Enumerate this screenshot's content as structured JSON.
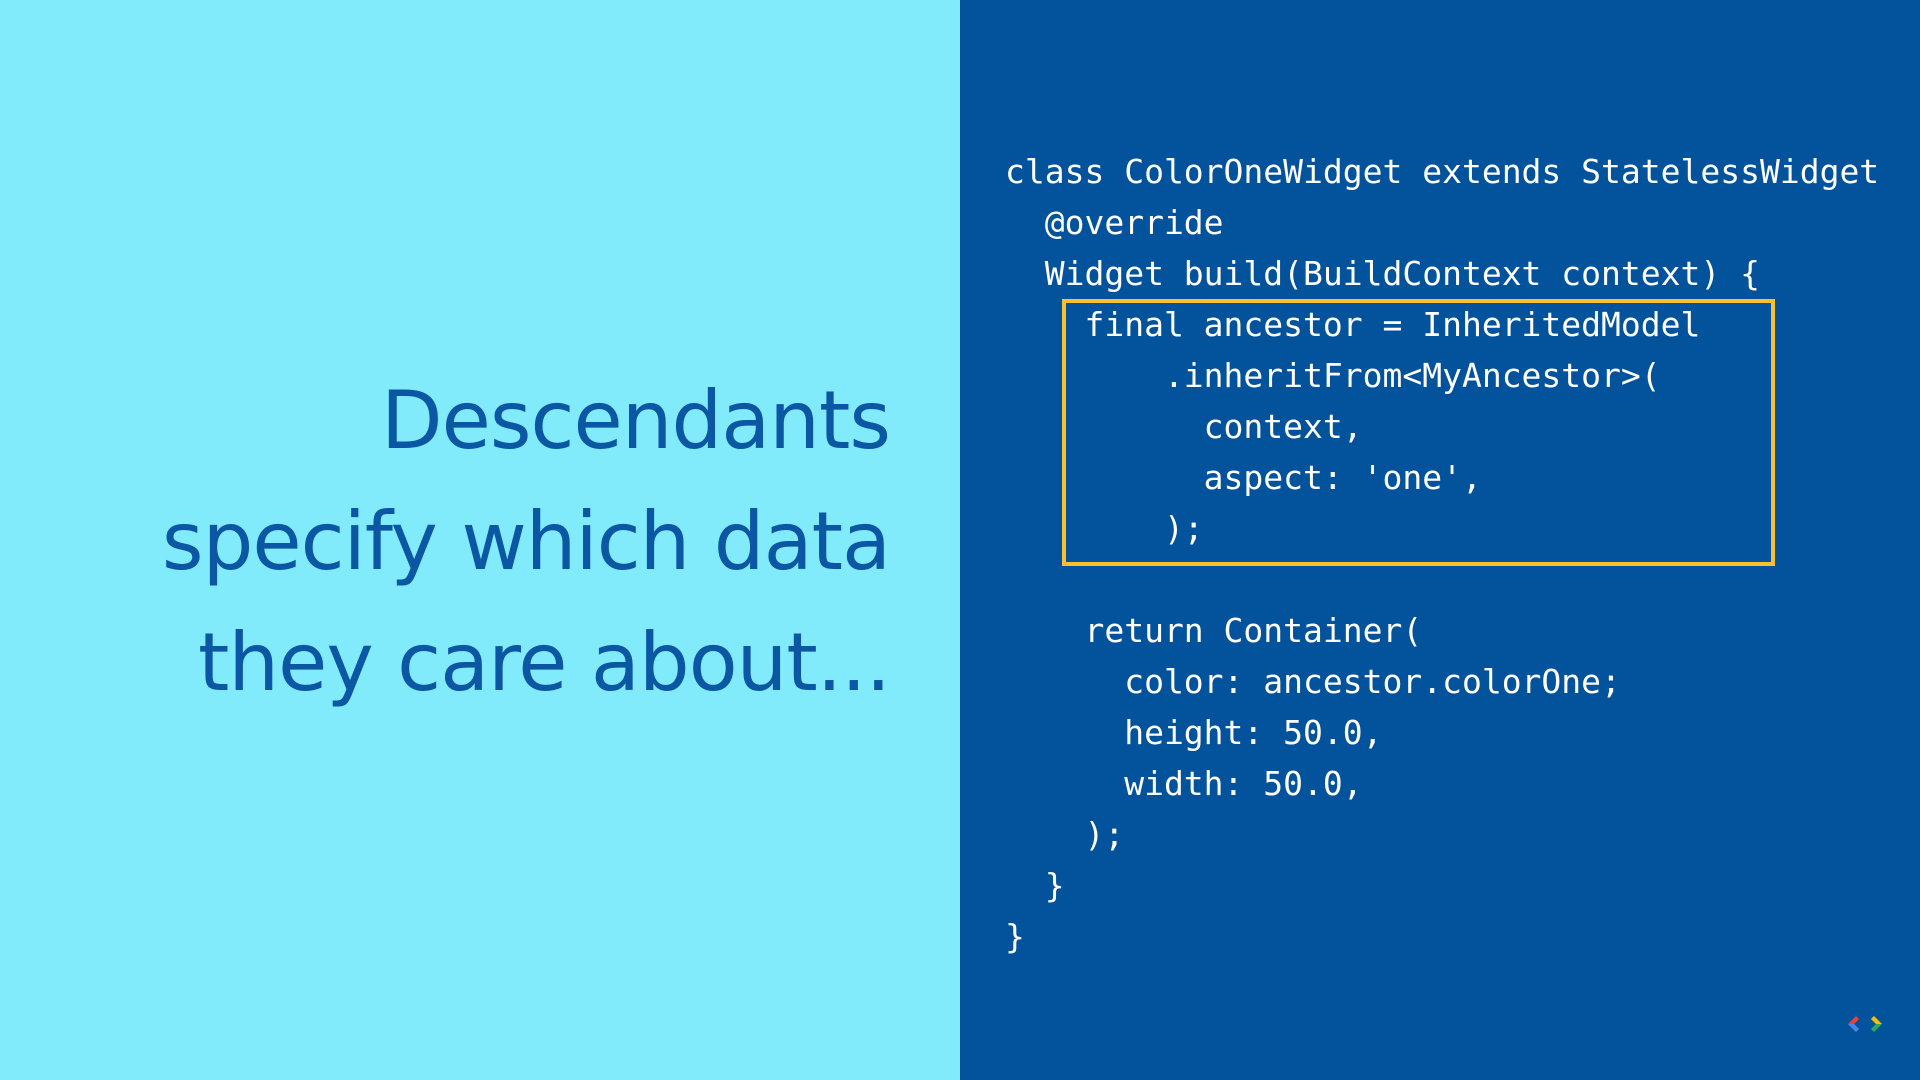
{
  "slide": {
    "headline_lines": [
      "Descendants",
      "specify which data",
      "they care about..."
    ]
  },
  "code": {
    "lines": [
      "class ColorOneWidget extends StatelessWidget",
      "  @override",
      "  Widget build(BuildContext context) {",
      "    final ancestor = InheritedModel",
      "        .inheritFrom<MyAncestor>(",
      "          context,",
      "          aspect: 'one',",
      "        );",
      "",
      "    return Container(",
      "      color: ancestor.colorOne;",
      "      height: 50.0,",
      "      width: 50.0,",
      "    );",
      "  }",
      "}"
    ],
    "highlight_color": "#fbc02d"
  },
  "colors": {
    "left_background": "#81ebfb",
    "right_background": "#02529c",
    "headline_text": "#0b57a4",
    "code_text": "#ffffff"
  },
  "logo": {
    "icon": "code-brackets-icon"
  }
}
